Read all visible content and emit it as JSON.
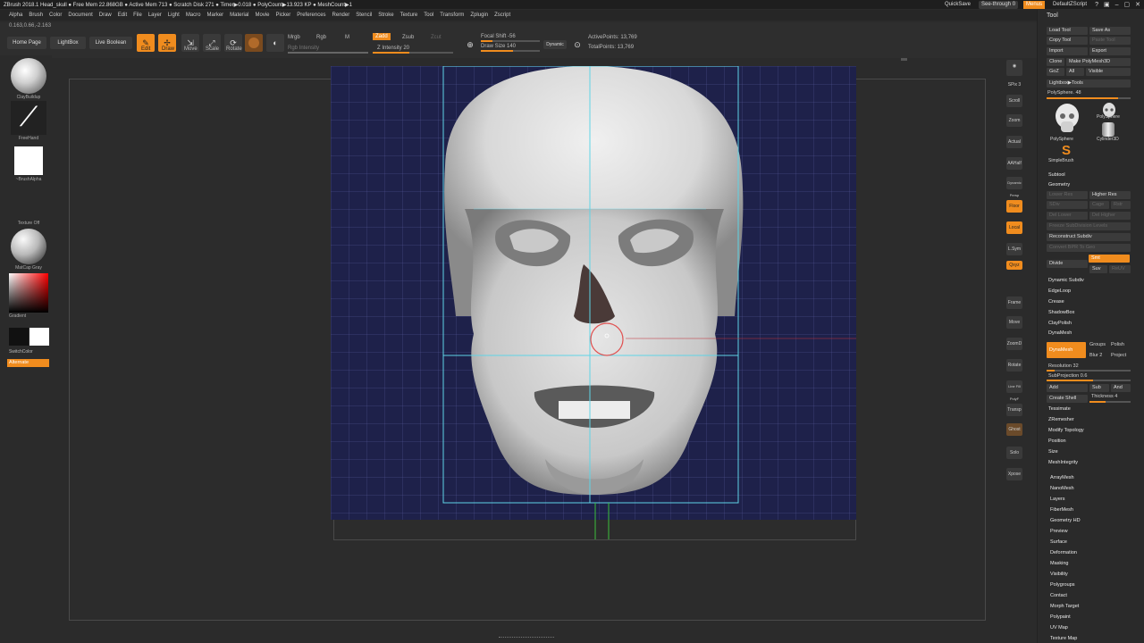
{
  "title_bar": {
    "text": "ZBrush 2018.1  Head_skull  ● Free Mem 22.868GB ● Active Mem 713 ● Scratch Disk 271 ● Timer▶0.018 ● PolyCount▶13.923 KP ● MeshCount▶1",
    "quicksave": "QuickSave",
    "see_through": "See-through  0",
    "menus": "Menus",
    "default_script": "DefaultZScript"
  },
  "menubar": [
    "Alpha",
    "Brush",
    "Color",
    "Document",
    "Draw",
    "Edit",
    "File",
    "Layer",
    "Light",
    "Macro",
    "Marker",
    "Material",
    "Movie",
    "Picker",
    "Preferences",
    "Render",
    "Stencil",
    "Stroke",
    "Texture",
    "Tool",
    "Transform",
    "Zplugin",
    "Zscript"
  ],
  "shelf": {
    "coords": "0.163,0.66,-2.163",
    "home_page": "Home Page",
    "lightbox": "LightBox",
    "live_boolean": "Live Boolean",
    "edit": "Edit",
    "draw": "Draw",
    "move": "Move",
    "scale": "Scale",
    "rotate": "Rotate",
    "mrgb": "Mrgb",
    "rgb": "Rgb",
    "m": "M",
    "rgb_intensity": "Rgb Intensity",
    "zadd": "Zadd",
    "zsub": "Zsub",
    "zcut": "Zcut",
    "z_intensity": "Z Intensity 20",
    "focal_shift": "Focal Shift -56",
    "draw_size": "Draw Size 140",
    "dynamic": "Dynamic",
    "active_points": "ActivePoints: 13,769",
    "total_points": "TotalPoints: 13,769"
  },
  "left_tray": {
    "brush": "ClayBuildup",
    "stroke": "FreeHand",
    "alpha": "~BrushAlpha",
    "texture": "Texture Off",
    "material": "MatCap Gray",
    "gradient": "Gradient",
    "switch_color": "SwitchColor",
    "alternate": "Alternate"
  },
  "right_tray": [
    "BPR",
    "SPix 3",
    "Scroll",
    "Zoom",
    "Actual",
    "AAHalf",
    "Dynamic Persp",
    "Floor",
    "Local",
    "L.Sym",
    "Qxyz",
    "Frame",
    "Move",
    "ZoomD",
    "Rotate",
    "Line Fill PolyF",
    "Transp",
    "Ghost",
    "Solo",
    "Xpose"
  ],
  "tool_palette": {
    "title": "Tool",
    "load_tool": "Load Tool",
    "save_as": "Save As",
    "copy_tool": "Copy Tool",
    "paste_tool": "Paste Tool",
    "import": "Import",
    "export": "Export",
    "clone": "Clone",
    "make_polymesh": "Make PolyMesh3D",
    "goz": "GoZ",
    "all": "All",
    "visible": "Visible",
    "lightbox_tools": "Lightbox▶Tools",
    "polysphere_slider": "PolySphere. 48",
    "thumbs": [
      "PolySphere",
      "PolySphere",
      "Cylinder3D",
      "SimpleBrush"
    ],
    "subtool": "Subtool",
    "geometry": "Geometry",
    "lower_res": "Lower Res",
    "higher_res": "Higher Res",
    "sdiv": "SDiv",
    "cage": "Cage",
    "rstr": "Rstr",
    "del_lower": "Del Lower",
    "del_higher": "Del Higher",
    "freeze_subdiv": "Freeze SubDivision Levels",
    "reconstruct_subdiv": "Reconstruct Subdiv",
    "convert_bpr": "Convert BPR To Geo",
    "divide": "Divide",
    "smt": "Smt",
    "suv": "Suv",
    "reuv": "ReUV",
    "geometry_items": [
      "Dynamic Subdiv",
      "EdgeLoop",
      "Crease",
      "ShadowBox",
      "ClayPolish",
      "DynaMesh"
    ],
    "dynamesh_btn": "DynaMesh",
    "groups": "Groups",
    "polish": "Polish",
    "blur": "Blur 2",
    "project": "Project",
    "resolution": "Resolution 32",
    "subprojection": "SubProjection 0.6",
    "add": "Add",
    "sub": "Sub",
    "and": "And",
    "create_shell": "Create Shell",
    "thickness": "Thickness 4",
    "geometry_items_2": [
      "Tessimate",
      "ZRemesher",
      "Modify Topology",
      "Position",
      "Size",
      "MeshIntegrity"
    ],
    "sections": [
      "ArrayMesh",
      "NanoMesh",
      "Layers",
      "FiberMesh",
      "Geometry HD",
      "Preview",
      "Surface",
      "Deformation",
      "Masking",
      "Visibility",
      "Polygroups",
      "Contact",
      "Morph Target",
      "Polypaint",
      "UV Map",
      "Texture Map"
    ]
  }
}
